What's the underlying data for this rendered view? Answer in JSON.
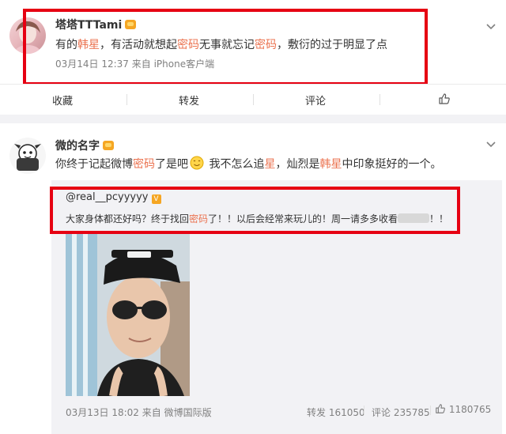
{
  "post1": {
    "username": "塔塔TTTami",
    "text": {
      "p1": "有的",
      "h1": "韩星",
      "p2": "，有活动就想起",
      "h2": "密码",
      "p3": "无事就忘记",
      "h3": "密码",
      "p4": "，敷衍的过于明显了点"
    },
    "meta": "03月14日 12:37  来自 iPhone客户端",
    "actions": {
      "collect": "收藏",
      "repost": "转发",
      "comment": "评论"
    }
  },
  "post2": {
    "username": "微的名字",
    "text": {
      "p1": "你终于记起微博",
      "h1": "密码",
      "p2": "了是吧",
      "p3": " 我不怎么追",
      "h2": "星",
      "p4": "，灿烈是",
      "h3": "韩星",
      "p5": "中印象挺好的一个。"
    },
    "repost": {
      "username": "@real__pcyyyyy",
      "text": {
        "p1": "大家身体都还好吗？终于找回",
        "h1": "密码",
        "p2": "了！！以后会经常来玩儿的！周一请多多收看",
        "p3": "！！"
      },
      "meta": "03月13日 18:02 来自 微博国际版",
      "repost_count": "转发 161050",
      "comment_count": "评论 235785",
      "like_count": "1180765"
    }
  },
  "colors": {
    "highlight": "#eb7350",
    "annotation_box": "#e60012",
    "meta": "#808080"
  },
  "icons": [
    "chevron-down-icon",
    "like-thumb-icon",
    "crown-badge-icon",
    "verified-badge-icon"
  ]
}
